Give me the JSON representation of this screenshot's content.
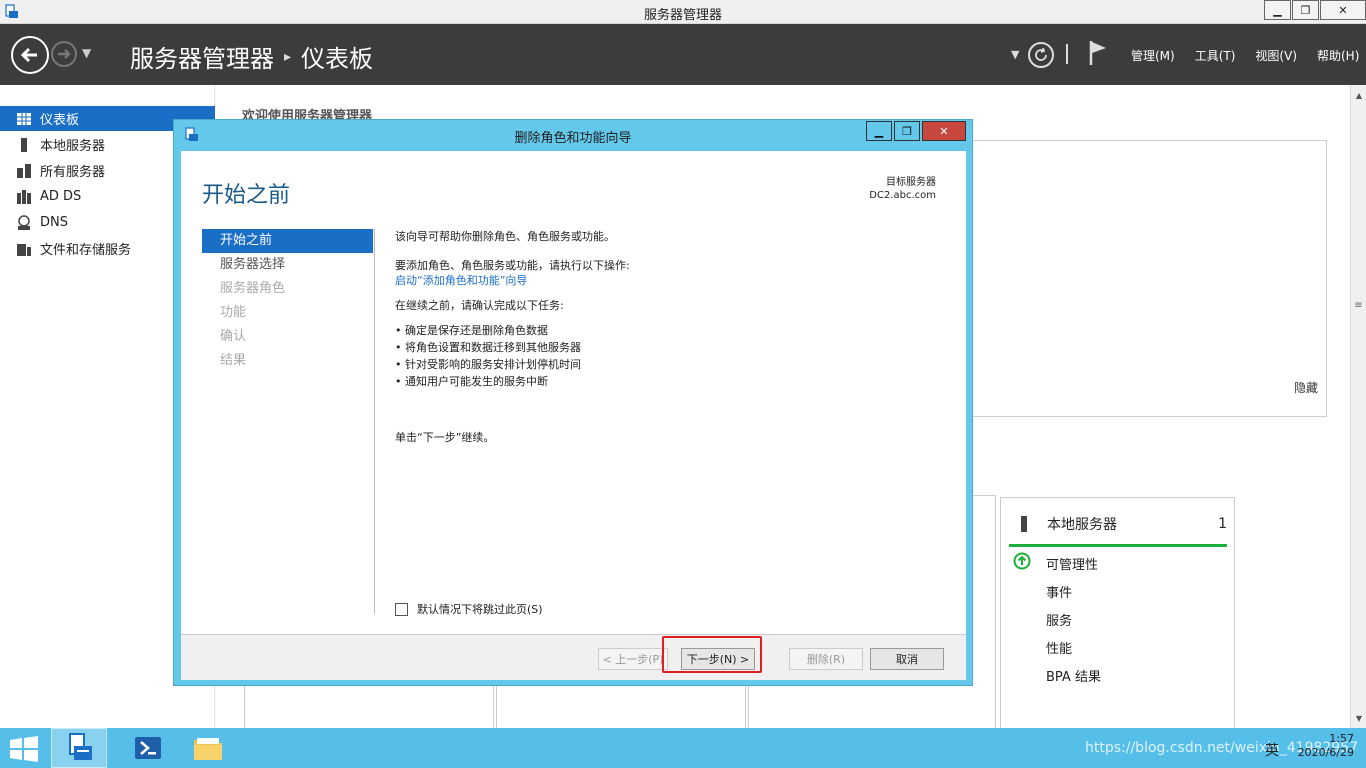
{
  "window": {
    "title": "服务器管理器",
    "min_glyph": "▁",
    "max_glyph": "❐",
    "close_glyph": "✕"
  },
  "header": {
    "breadcrumb_app": "服务器管理器",
    "breadcrumb_sep": "▸",
    "breadcrumb_page": "仪表板",
    "menus": [
      "管理(M)",
      "工具(T)",
      "视图(V)",
      "帮助(H)"
    ]
  },
  "sidebar": {
    "items": [
      {
        "label": "仪表板",
        "icon": "dashboard-icon",
        "active": true
      },
      {
        "label": "本地服务器",
        "icon": "server-icon",
        "active": false
      },
      {
        "label": "所有服务器",
        "icon": "servers-icon",
        "active": false
      },
      {
        "label": "AD DS",
        "icon": "adds-icon",
        "active": false
      },
      {
        "label": "DNS",
        "icon": "dns-icon",
        "active": false
      },
      {
        "label": "文件和存储服务",
        "icon": "file-storage-icon",
        "active": false
      }
    ]
  },
  "main": {
    "welcome": "欢迎使用服务器管理器",
    "hide_link": "隐藏",
    "local_server_card": {
      "title": "本地服务器",
      "count": "1",
      "rows": [
        "可管理性",
        "事件",
        "服务",
        "性能",
        "BPA 结果"
      ]
    }
  },
  "dialog": {
    "title": "删除角色和功能向导",
    "heading": "开始之前",
    "target_label": "目标服务器",
    "target_server": "DC2.abc.com",
    "steps": [
      {
        "label": "开始之前",
        "state": "active"
      },
      {
        "label": "服务器选择",
        "state": "enabled"
      },
      {
        "label": "服务器角色",
        "state": "disabled"
      },
      {
        "label": "功能",
        "state": "disabled"
      },
      {
        "label": "确认",
        "state": "disabled"
      },
      {
        "label": "结果",
        "state": "disabled"
      }
    ],
    "intro": "该向导可帮助你删除角色、角色服务或功能。",
    "add_text": "要添加角色、角色服务或功能，请执行以下操作:",
    "add_link": "启动“添加角色和功能”向导",
    "before_text": "在继续之前，请确认完成以下任务:",
    "tasks": [
      "确定是保存还是删除角色数据",
      "将角色设置和数据迁移到其他服务器",
      "针对受影响的服务安排计划停机时间",
      "通知用户可能发生的服务中断"
    ],
    "continue_text": "单击“下一步”继续。",
    "skip_label": "默认情况下将跳过此页(S)",
    "buttons": {
      "prev": "< 上一步(P)",
      "next": "下一步(N) >",
      "remove": "删除(R)",
      "cancel": "取消"
    }
  },
  "taskbar": {
    "time": "1:57",
    "date": "2020/6/29",
    "ime": "英",
    "watermark": "https://blog.csdn.net/weixin_41982957"
  },
  "colors": {
    "accent": "#1a6ec5",
    "dialog_frame": "#64c8ea",
    "header_bg": "#3c3c3c",
    "ok_green": "#1fb03c",
    "highlight_red": "#e02020"
  }
}
